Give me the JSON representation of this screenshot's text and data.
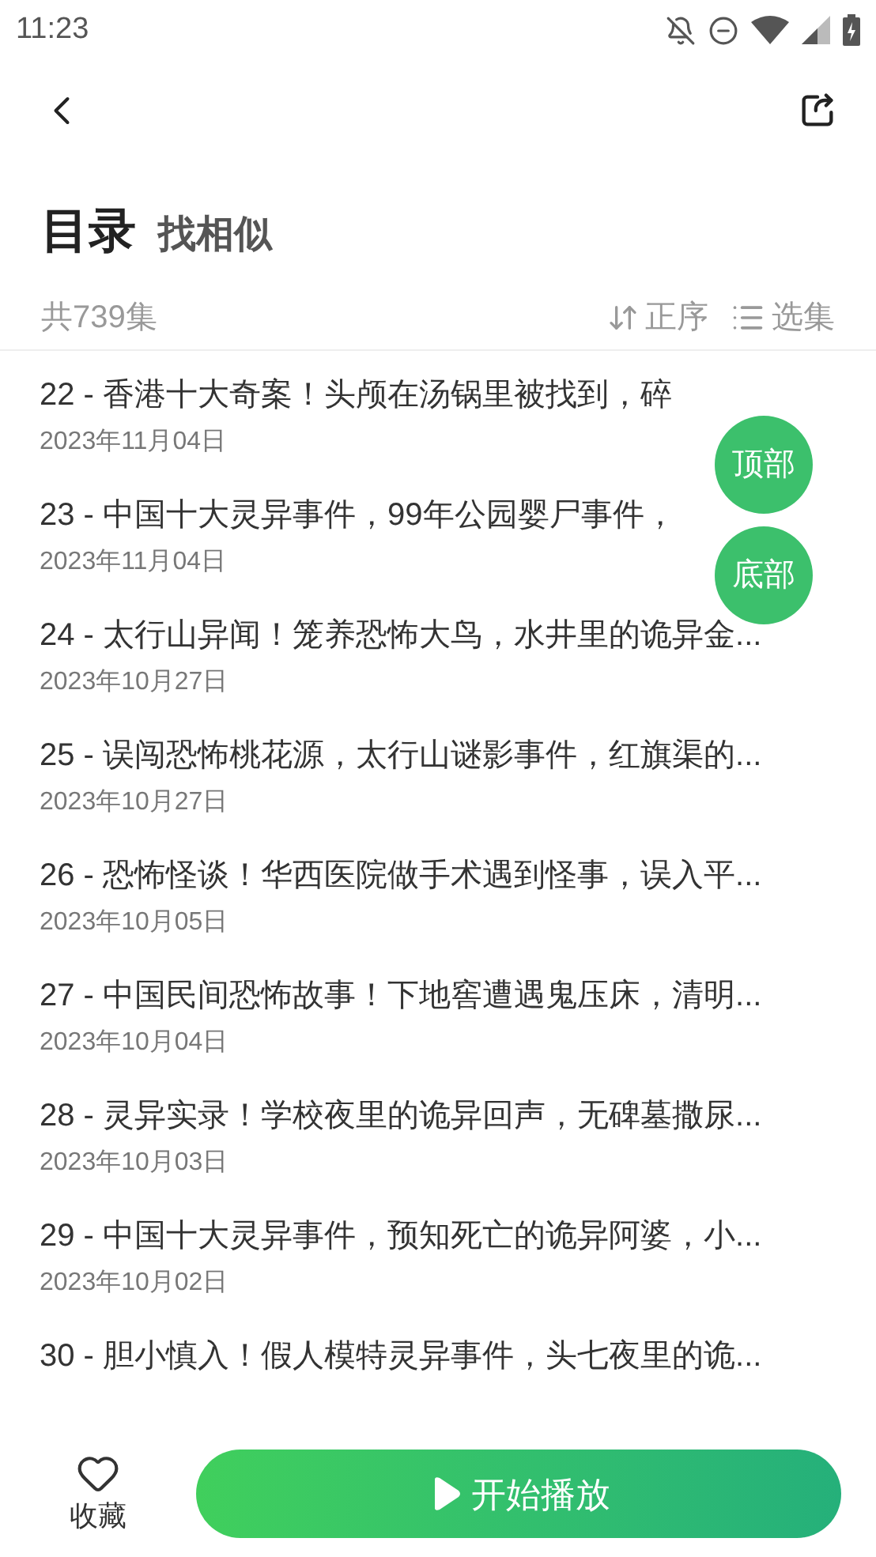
{
  "status_bar": {
    "time": "11:23"
  },
  "header": {
    "title": "目录",
    "similar_tab": "找相似"
  },
  "list_toolbar": {
    "count": "共739集",
    "sort": "正序",
    "select": "选集"
  },
  "episodes": [
    {
      "title": "22 - 香港十大奇案！头颅在汤锅里被找到，碎",
      "date": "2023年11月04日"
    },
    {
      "title": "23 - 中国十大灵异事件，99年公园婴尸事件，",
      "date": "2023年11月04日"
    },
    {
      "title": "24 - 太行山异闻！笼养恐怖大鸟，水井里的诡异金...",
      "date": "2023年10月27日"
    },
    {
      "title": "25 - 误闯恐怖桃花源，太行山谜影事件，红旗渠的...",
      "date": "2023年10月27日"
    },
    {
      "title": "26 - 恐怖怪谈！华西医院做手术遇到怪事，误入平...",
      "date": "2023年10月05日"
    },
    {
      "title": "27 - 中国民间恐怖故事！下地窖遭遇鬼压床，清明...",
      "date": "2023年10月04日"
    },
    {
      "title": "28 - 灵异实录！学校夜里的诡异回声，无碑墓撒尿...",
      "date": "2023年10月03日"
    },
    {
      "title": "29 - 中国十大灵异事件，预知死亡的诡异阿婆，小...",
      "date": "2023年10月02日"
    },
    {
      "title": "30 - 胆小慎入！假人模特灵异事件，头七夜里的诡..."
    }
  ],
  "floating_buttons": [
    "顶部",
    "底部"
  ],
  "bottom_bar": {
    "favorite": "收藏",
    "play": "开始播放"
  }
}
